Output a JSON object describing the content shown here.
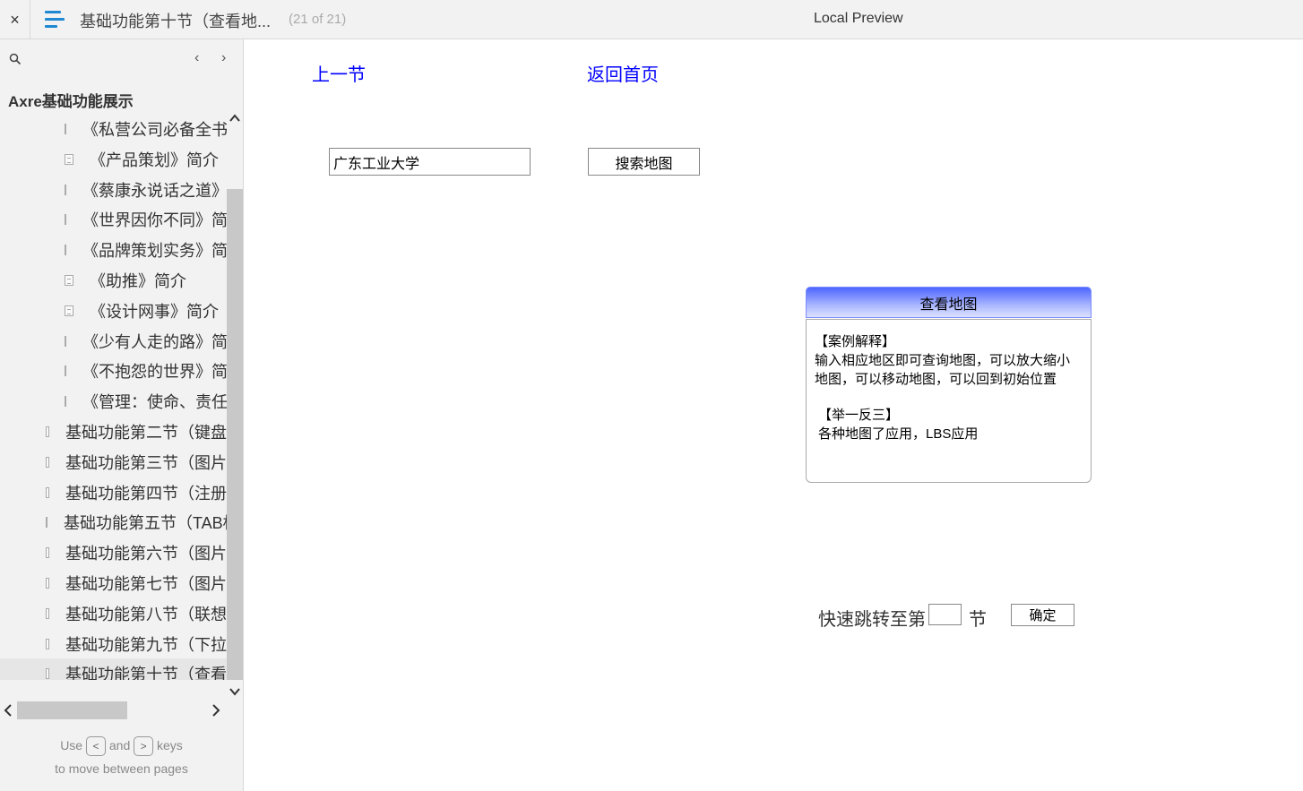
{
  "topbar": {
    "close_icon": "×",
    "page_title": "基础功能第十节（查看地...",
    "page_count": "(21 of 21)",
    "preview_label": "Local Preview"
  },
  "sidebar": {
    "nav_prev": "‹",
    "nav_next": "›",
    "root_label": "Axre基础功能展示",
    "items": [
      {
        "label": "《私营公司必备全书》",
        "level": 2
      },
      {
        "label": "《产品策划》简介",
        "level": 2
      },
      {
        "label": "《蔡康永说话之道》",
        "level": 2
      },
      {
        "label": "《世界因你不同》简介",
        "level": 2
      },
      {
        "label": "《品牌策划实务》简介",
        "level": 2
      },
      {
        "label": "《助推》简介",
        "level": 2
      },
      {
        "label": "《设计网事》简介",
        "level": 2
      },
      {
        "label": "《少有人走的路》简介",
        "level": 2
      },
      {
        "label": "《不抱怨的世界》简介",
        "level": 2
      },
      {
        "label": "《管理：使命、责任",
        "level": 2
      },
      {
        "label": "基础功能第二节（键盘",
        "level": 1
      },
      {
        "label": "基础功能第三节（图片",
        "level": 1
      },
      {
        "label": "基础功能第四节（注册",
        "level": 1
      },
      {
        "label": "基础功能第五节（TAB标",
        "level": 1
      },
      {
        "label": "基础功能第六节（图片",
        "level": 1
      },
      {
        "label": "基础功能第七节（图片",
        "level": 1
      },
      {
        "label": "基础功能第八节（联想",
        "level": 1
      },
      {
        "label": "基础功能第九节（下拉",
        "level": 1
      },
      {
        "label": "基础功能第十节（查看",
        "level": 1,
        "selected": true
      }
    ],
    "hint": {
      "use": "Use",
      "key_prev": "<",
      "and": "and",
      "key_next": ">",
      "keys": "keys",
      "line2": "to move between pages"
    }
  },
  "main": {
    "prev_link": "上一节",
    "home_link": "返回首页",
    "search_value": "广东工业大学",
    "search_button": "搜索地图",
    "view_map_button": "查看地图",
    "info": {
      "case_title": "【案例解释】",
      "case_text": "输入相应地区即可查询地图，可以放大缩小地图，可以移动地图，可以回到初始位置",
      "extend_title": "【举一反三】",
      "extend_text": "各种地图了应用，LBS应用"
    },
    "jump": {
      "label": "快速跳转至第",
      "unit": "节",
      "value": "",
      "confirm": "确定"
    }
  },
  "colors": {
    "link": "#0000ff",
    "menu_icon": "#1e88d2",
    "button_gradient_top": "#4d66ff"
  }
}
